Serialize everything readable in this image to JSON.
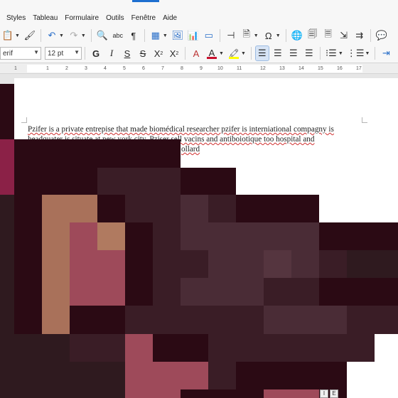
{
  "menu": {
    "items": [
      "Styles",
      "Tableau",
      "Formulaire",
      "Outils",
      "Fenêtre",
      "Aide"
    ]
  },
  "toolbar": {
    "font_name": "erif",
    "font_size": "12 pt",
    "bold": "G",
    "italic": "I",
    "underline": "S",
    "strike": "S",
    "superscript": "X",
    "subscript": "X",
    "spellcheck": "abc",
    "pilcrow": "¶",
    "omega": "Ω",
    "clear_format": "A",
    "font_color": "A"
  },
  "ruler": {
    "ticks": [
      "1",
      "1",
      "2",
      "3",
      "4",
      "5",
      "6",
      "7",
      "8",
      "9",
      "10",
      "11",
      "12",
      "13",
      "14",
      "15",
      "16",
      "17"
    ]
  },
  "document": {
    "line1": "Pzifer is a  private entrepise that made biomédical researcher  pzifer is interniational compagny is",
    "line2": "headquater is situate at new york city. Pziser sell  vacins and antiboiotique too hospital  and",
    "line3": "ollard"
  },
  "colors": {
    "accent": "#1e6fd0",
    "font_color_bar": "#c8102e",
    "highlight_bar": "#ffff00",
    "spell_error": "#d12f2f"
  },
  "status": {
    "btn1": "I",
    "btn2": "E"
  }
}
